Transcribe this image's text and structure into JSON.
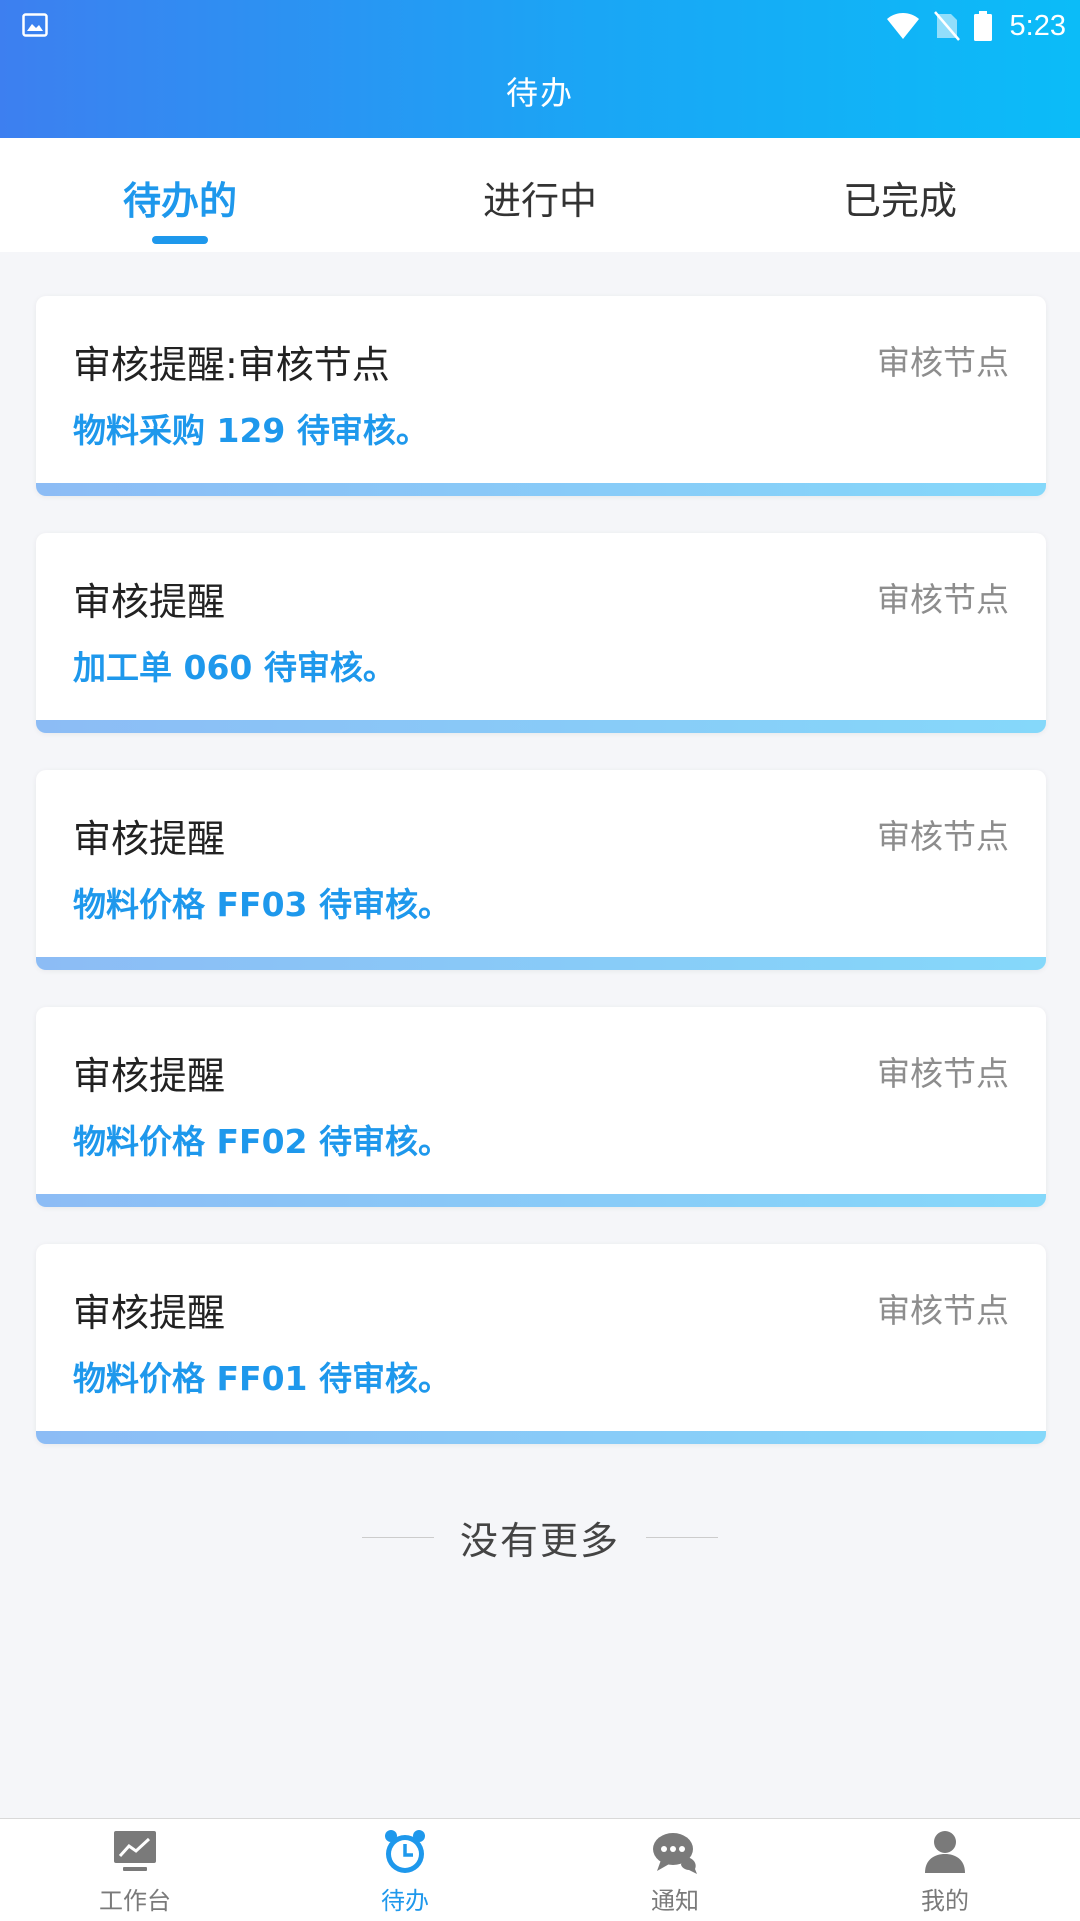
{
  "status_bar": {
    "time": "5:23"
  },
  "header": {
    "title": "待办"
  },
  "tabs": [
    {
      "label": "待办的",
      "active": true
    },
    {
      "label": "进行中",
      "active": false
    },
    {
      "label": "已完成",
      "active": false
    }
  ],
  "cards": [
    {
      "title": "审核提醒:审核节点",
      "tag": "审核节点",
      "desc": "物料采购 129 待审核。"
    },
    {
      "title": "审核提醒",
      "tag": "审核节点",
      "desc": "加工单 060 待审核。"
    },
    {
      "title": "审核提醒",
      "tag": "审核节点",
      "desc": "物料价格 FF03 待审核。"
    },
    {
      "title": "审核提醒",
      "tag": "审核节点",
      "desc": "物料价格 FF02 待审核。"
    },
    {
      "title": "审核提醒",
      "tag": "审核节点",
      "desc": "物料价格 FF01 待审核。"
    }
  ],
  "footer_text": "没有更多",
  "bottom_nav": [
    {
      "label": "工作台",
      "icon": "workbench-icon",
      "active": false
    },
    {
      "label": "待办",
      "icon": "alarm-clock-icon",
      "active": true
    },
    {
      "label": "通知",
      "icon": "chat-bubble-icon",
      "active": false
    },
    {
      "label": "我的",
      "icon": "person-icon",
      "active": false
    }
  ],
  "colors": {
    "accent": "#1e98ec",
    "header_start": "#3d7ff0",
    "header_end": "#0bbcf8",
    "card_bar_start": "#8cbcf5",
    "card_bar_end": "#85d8fa",
    "background": "#f5f6f9"
  }
}
